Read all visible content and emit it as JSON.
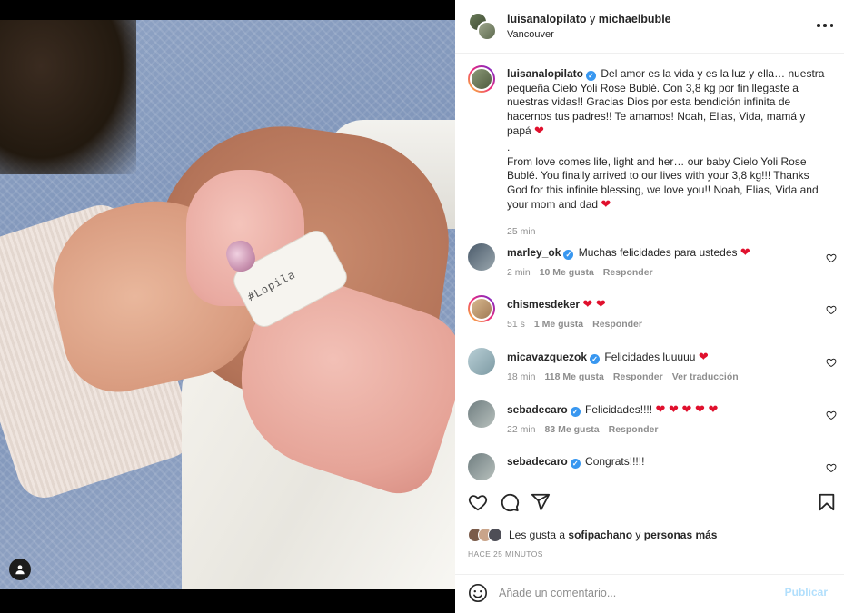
{
  "header": {
    "user1": "luisanalopilato",
    "joiner": "y",
    "user2": "michaelbuble",
    "location": "Vancouver"
  },
  "photo": {
    "wristband_text": "#Lopila"
  },
  "caption": {
    "username": "luisanalopilato",
    "text_es": "Del amor es la vida y es la luz y ella… nuestra pequeña Cielo Yoli Rose Bublé. Con 3,8 kg por fin llegaste a nuestras vidas!! Gracias Dios por esta bendición infinita de hacernos tus padres!! Te amamos! Noah, Elias, Vida, mamá y papá",
    "dot": ".",
    "text_en": "From love comes life, light and her… our baby Cielo Yoli Rose Bublé. You finally arrived to our lives with your 3,8 kg!!! Thanks God for this infinite blessing, we love you!! Noah, Elias, Vida and your mom and dad",
    "time": "25 min"
  },
  "comments": [
    {
      "username": "marley_ok",
      "verified": true,
      "text": "Muchas felicidades para ustedes",
      "hearts": "❤",
      "time": "2 min",
      "likes": "10 Me gusta",
      "reply": "Responder",
      "translate": ""
    },
    {
      "username": "chismesdeker",
      "verified": false,
      "text": "",
      "hearts": "❤ ❤",
      "time": "51 s",
      "likes": "1 Me gusta",
      "reply": "Responder",
      "translate": ""
    },
    {
      "username": "micavazquezok",
      "verified": true,
      "text": "Felicidades luuuuu",
      "hearts": "❤",
      "time": "18 min",
      "likes": "118 Me gusta",
      "reply": "Responder",
      "translate": "Ver traducción"
    },
    {
      "username": "sebadecaro",
      "verified": true,
      "text": "Felicidades!!!!",
      "hearts": "❤ ❤ ❤ ❤ ❤",
      "time": "22 min",
      "likes": "83 Me gusta",
      "reply": "Responder",
      "translate": ""
    },
    {
      "username": "sebadecaro",
      "verified": true,
      "text": "Congrats!!!!!",
      "hearts": "",
      "time": "",
      "likes": "",
      "reply": "",
      "translate": ""
    }
  ],
  "likes": {
    "prefix": "Les gusta a",
    "user": "sofipachano",
    "joiner": "y",
    "others": "personas más"
  },
  "time_ago": "HACE 25 MINUTOS",
  "comment_bar": {
    "placeholder": "Añade un comentario...",
    "publish_label": "Publicar"
  },
  "icons": {
    "more": "more-dots-icon",
    "like": "heart-icon",
    "comment": "comment-icon",
    "share": "share-icon",
    "save": "bookmark-icon",
    "emoji": "emoji-icon",
    "user_tag": "user-tag-icon"
  },
  "colors": {
    "verified": "#3897f0",
    "heart": "#e0102d",
    "publish_disabled": "#b2dffc",
    "muted": "#8e8e8e"
  }
}
